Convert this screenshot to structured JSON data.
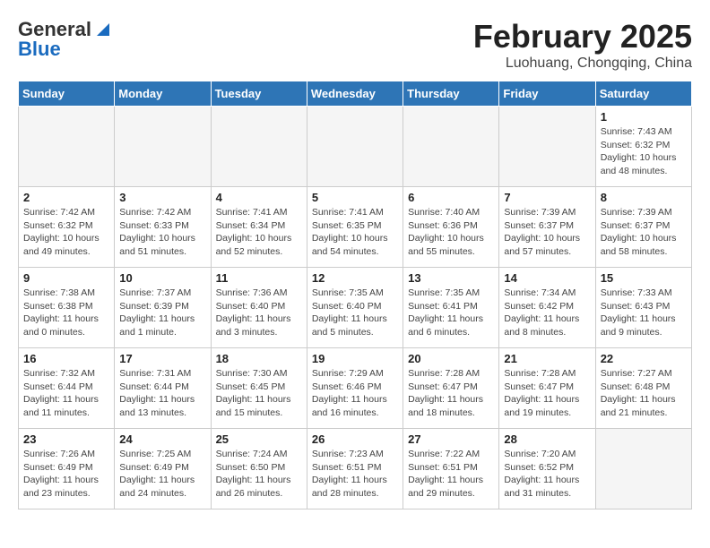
{
  "header": {
    "logo_general": "General",
    "logo_blue": "Blue",
    "month_year": "February 2025",
    "location": "Luohuang, Chongqing, China"
  },
  "weekdays": [
    "Sunday",
    "Monday",
    "Tuesday",
    "Wednesday",
    "Thursday",
    "Friday",
    "Saturday"
  ],
  "weeks": [
    [
      {
        "day": "",
        "info": ""
      },
      {
        "day": "",
        "info": ""
      },
      {
        "day": "",
        "info": ""
      },
      {
        "day": "",
        "info": ""
      },
      {
        "day": "",
        "info": ""
      },
      {
        "day": "",
        "info": ""
      },
      {
        "day": "1",
        "info": "Sunrise: 7:43 AM\nSunset: 6:32 PM\nDaylight: 10 hours\nand 48 minutes."
      }
    ],
    [
      {
        "day": "2",
        "info": "Sunrise: 7:42 AM\nSunset: 6:32 PM\nDaylight: 10 hours\nand 49 minutes."
      },
      {
        "day": "3",
        "info": "Sunrise: 7:42 AM\nSunset: 6:33 PM\nDaylight: 10 hours\nand 51 minutes."
      },
      {
        "day": "4",
        "info": "Sunrise: 7:41 AM\nSunset: 6:34 PM\nDaylight: 10 hours\nand 52 minutes."
      },
      {
        "day": "5",
        "info": "Sunrise: 7:41 AM\nSunset: 6:35 PM\nDaylight: 10 hours\nand 54 minutes."
      },
      {
        "day": "6",
        "info": "Sunrise: 7:40 AM\nSunset: 6:36 PM\nDaylight: 10 hours\nand 55 minutes."
      },
      {
        "day": "7",
        "info": "Sunrise: 7:39 AM\nSunset: 6:37 PM\nDaylight: 10 hours\nand 57 minutes."
      },
      {
        "day": "8",
        "info": "Sunrise: 7:39 AM\nSunset: 6:37 PM\nDaylight: 10 hours\nand 58 minutes."
      }
    ],
    [
      {
        "day": "9",
        "info": "Sunrise: 7:38 AM\nSunset: 6:38 PM\nDaylight: 11 hours\nand 0 minutes."
      },
      {
        "day": "10",
        "info": "Sunrise: 7:37 AM\nSunset: 6:39 PM\nDaylight: 11 hours\nand 1 minute."
      },
      {
        "day": "11",
        "info": "Sunrise: 7:36 AM\nSunset: 6:40 PM\nDaylight: 11 hours\nand 3 minutes."
      },
      {
        "day": "12",
        "info": "Sunrise: 7:35 AM\nSunset: 6:40 PM\nDaylight: 11 hours\nand 5 minutes."
      },
      {
        "day": "13",
        "info": "Sunrise: 7:35 AM\nSunset: 6:41 PM\nDaylight: 11 hours\nand 6 minutes."
      },
      {
        "day": "14",
        "info": "Sunrise: 7:34 AM\nSunset: 6:42 PM\nDaylight: 11 hours\nand 8 minutes."
      },
      {
        "day": "15",
        "info": "Sunrise: 7:33 AM\nSunset: 6:43 PM\nDaylight: 11 hours\nand 9 minutes."
      }
    ],
    [
      {
        "day": "16",
        "info": "Sunrise: 7:32 AM\nSunset: 6:44 PM\nDaylight: 11 hours\nand 11 minutes."
      },
      {
        "day": "17",
        "info": "Sunrise: 7:31 AM\nSunset: 6:44 PM\nDaylight: 11 hours\nand 13 minutes."
      },
      {
        "day": "18",
        "info": "Sunrise: 7:30 AM\nSunset: 6:45 PM\nDaylight: 11 hours\nand 15 minutes."
      },
      {
        "day": "19",
        "info": "Sunrise: 7:29 AM\nSunset: 6:46 PM\nDaylight: 11 hours\nand 16 minutes."
      },
      {
        "day": "20",
        "info": "Sunrise: 7:28 AM\nSunset: 6:47 PM\nDaylight: 11 hours\nand 18 minutes."
      },
      {
        "day": "21",
        "info": "Sunrise: 7:28 AM\nSunset: 6:47 PM\nDaylight: 11 hours\nand 19 minutes."
      },
      {
        "day": "22",
        "info": "Sunrise: 7:27 AM\nSunset: 6:48 PM\nDaylight: 11 hours\nand 21 minutes."
      }
    ],
    [
      {
        "day": "23",
        "info": "Sunrise: 7:26 AM\nSunset: 6:49 PM\nDaylight: 11 hours\nand 23 minutes."
      },
      {
        "day": "24",
        "info": "Sunrise: 7:25 AM\nSunset: 6:49 PM\nDaylight: 11 hours\nand 24 minutes."
      },
      {
        "day": "25",
        "info": "Sunrise: 7:24 AM\nSunset: 6:50 PM\nDaylight: 11 hours\nand 26 minutes."
      },
      {
        "day": "26",
        "info": "Sunrise: 7:23 AM\nSunset: 6:51 PM\nDaylight: 11 hours\nand 28 minutes."
      },
      {
        "day": "27",
        "info": "Sunrise: 7:22 AM\nSunset: 6:51 PM\nDaylight: 11 hours\nand 29 minutes."
      },
      {
        "day": "28",
        "info": "Sunrise: 7:20 AM\nSunset: 6:52 PM\nDaylight: 11 hours\nand 31 minutes."
      },
      {
        "day": "",
        "info": ""
      }
    ]
  ]
}
